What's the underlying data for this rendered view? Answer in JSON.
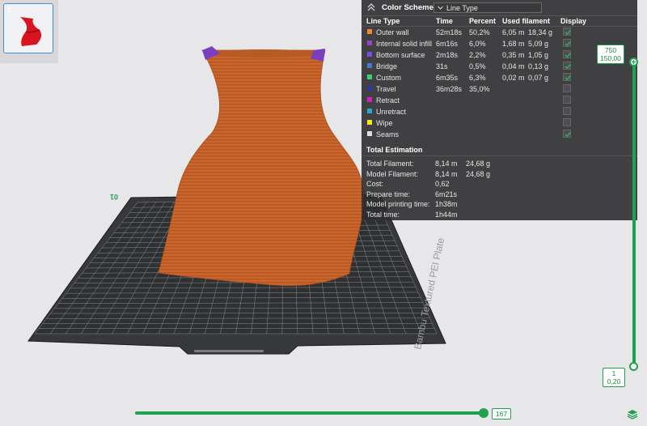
{
  "thumbnail": {
    "index": "1"
  },
  "color_scheme": {
    "title": "Color Scheme",
    "selected": "Line Type",
    "columns": [
      "Line Type",
      "Time",
      "Percent",
      "Used filament",
      "Display"
    ],
    "rows": [
      {
        "name": "Outer wall",
        "color": "#e88b3a",
        "time": "52m18s",
        "percent": "50,2%",
        "length": "6,05 m",
        "weight": "18,34 g",
        "display": true
      },
      {
        "name": "Internal solid infill",
        "color": "#9a42c8",
        "time": "6m16s",
        "percent": "6,0%",
        "length": "1,68 m",
        "weight": "5,09 g",
        "display": true
      },
      {
        "name": "Bottom surface",
        "color": "#7a4fe0",
        "time": "2m18s",
        "percent": "2,2%",
        "length": "0,35 m",
        "weight": "1,05 g",
        "display": true
      },
      {
        "name": "Bridge",
        "color": "#4a78d0",
        "time": "31s",
        "percent": "0,5%",
        "length": "0,04 m",
        "weight": "0,13 g",
        "display": true
      },
      {
        "name": "Custom",
        "color": "#3ecf7a",
        "time": "6m35s",
        "percent": "6,3%",
        "length": "0,02 m",
        "weight": "0,07 g",
        "display": true
      },
      {
        "name": "Travel",
        "color": "#2a3aa0",
        "time": "36m28s",
        "percent": "35,0%",
        "length": "",
        "weight": "",
        "display": false
      },
      {
        "name": "Retract",
        "color": "#d020c8",
        "time": "",
        "percent": "",
        "length": "",
        "weight": "",
        "display": false
      },
      {
        "name": "Unretract",
        "color": "#2aa6c8",
        "time": "",
        "percent": "",
        "length": "",
        "weight": "",
        "display": false
      },
      {
        "name": "Wipe",
        "color": "#f2e81a",
        "time": "",
        "percent": "",
        "length": "",
        "weight": "",
        "display": false
      },
      {
        "name": "Seams",
        "color": "#e0e0e0",
        "time": "",
        "percent": "",
        "length": "",
        "weight": "",
        "display": true
      }
    ]
  },
  "estimation": {
    "title": "Total Estimation",
    "rows": [
      {
        "label": "Total Filament:",
        "length": "8,14 m",
        "weight": "24,68 g"
      },
      {
        "label": "Model Filament:",
        "length": "8,14 m",
        "weight": "24,68 g"
      },
      {
        "label": "Cost:",
        "length": "0,62",
        "weight": ""
      },
      {
        "label": "Prepare time:",
        "length": "6m21s",
        "weight": ""
      },
      {
        "label": "Model printing time:",
        "length": "1h38m",
        "weight": ""
      },
      {
        "label": "Total time:",
        "length": "1h44m",
        "weight": ""
      }
    ]
  },
  "layer_slider": {
    "top_layer": "750",
    "top_height": "150,00",
    "bottom_layer": "1",
    "bottom_height": "0,20"
  },
  "move_slider": {
    "value": "167"
  },
  "plate": {
    "label": "Bambu Textured PEI Plate",
    "number": "01"
  },
  "colors": {
    "accent": "#1fa14f",
    "model": "#c8642c",
    "panel": "#2e2e30"
  }
}
